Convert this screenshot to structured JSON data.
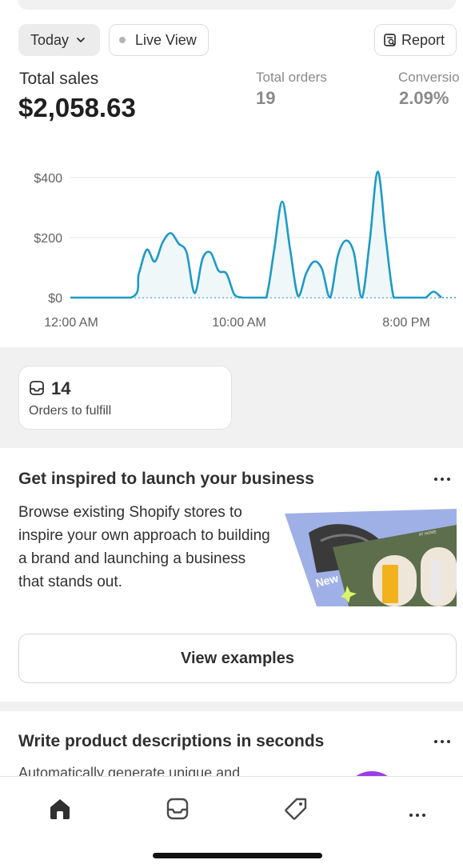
{
  "filters": {
    "date_label": "Today",
    "live_label": "Live View",
    "report_label": "Report"
  },
  "metrics": {
    "total_sales_label": "Total sales",
    "total_sales_value": "$2,058.63",
    "total_orders_label": "Total orders",
    "total_orders_value": "19",
    "conversion_label": "Conversio",
    "conversion_value": "2.09%"
  },
  "chart_data": {
    "type": "line",
    "y_ticks": [
      "$400",
      "$200",
      "$0"
    ],
    "x_ticks": [
      "12:00 AM",
      "10:00 AM",
      "8:00 PM"
    ],
    "ylim": [
      0,
      450
    ],
    "x_range_hours": [
      0,
      24
    ],
    "series": [
      {
        "color": "#1d9ac7",
        "x": [
          0,
          3.8,
          4.3,
          4.8,
          5.3,
          5.8,
          6.3,
          6.8,
          7.3,
          7.8,
          8.3,
          8.8,
          9.3,
          9.8,
          10.3,
          10.8,
          11.3,
          11.8,
          12.3,
          12.8,
          13.3,
          13.8,
          14.3,
          14.8,
          15.3,
          15.8,
          16.3,
          16.8,
          17.3,
          17.8,
          18.3,
          18.8,
          19.3,
          19.8,
          20.3,
          20.8,
          21.3,
          21.8,
          22.3,
          22.8,
          23.3
        ],
        "values": [
          0,
          0,
          80,
          160,
          120,
          185,
          215,
          180,
          150,
          15,
          130,
          150,
          90,
          80,
          10,
          0,
          0,
          0,
          0,
          160,
          320,
          160,
          5,
          80,
          120,
          95,
          0,
          140,
          190,
          150,
          0,
          190,
          420,
          200,
          0,
          0,
          0,
          0,
          0,
          20,
          0
        ]
      }
    ],
    "comparison_series": {
      "style": "dotted",
      "color": "#1d9ac7",
      "values_constant": 0
    }
  },
  "fulfill": {
    "count": "14",
    "caption": "Orders to fulfill"
  },
  "inspire_card": {
    "title": "Get inspired to launch your business",
    "body": "Browse existing Shopify stores to inspire your own approach to building a brand and launching a business that stands out.",
    "button_label": "View examples",
    "image_text_1": "New",
    "image_text_2": "AT HOME"
  },
  "ai_card": {
    "title": "Write product descriptions in seconds",
    "body": "Automatically generate unique and"
  },
  "tabs": [
    "home-icon",
    "orders-icon",
    "products-icon",
    "more-icon"
  ]
}
